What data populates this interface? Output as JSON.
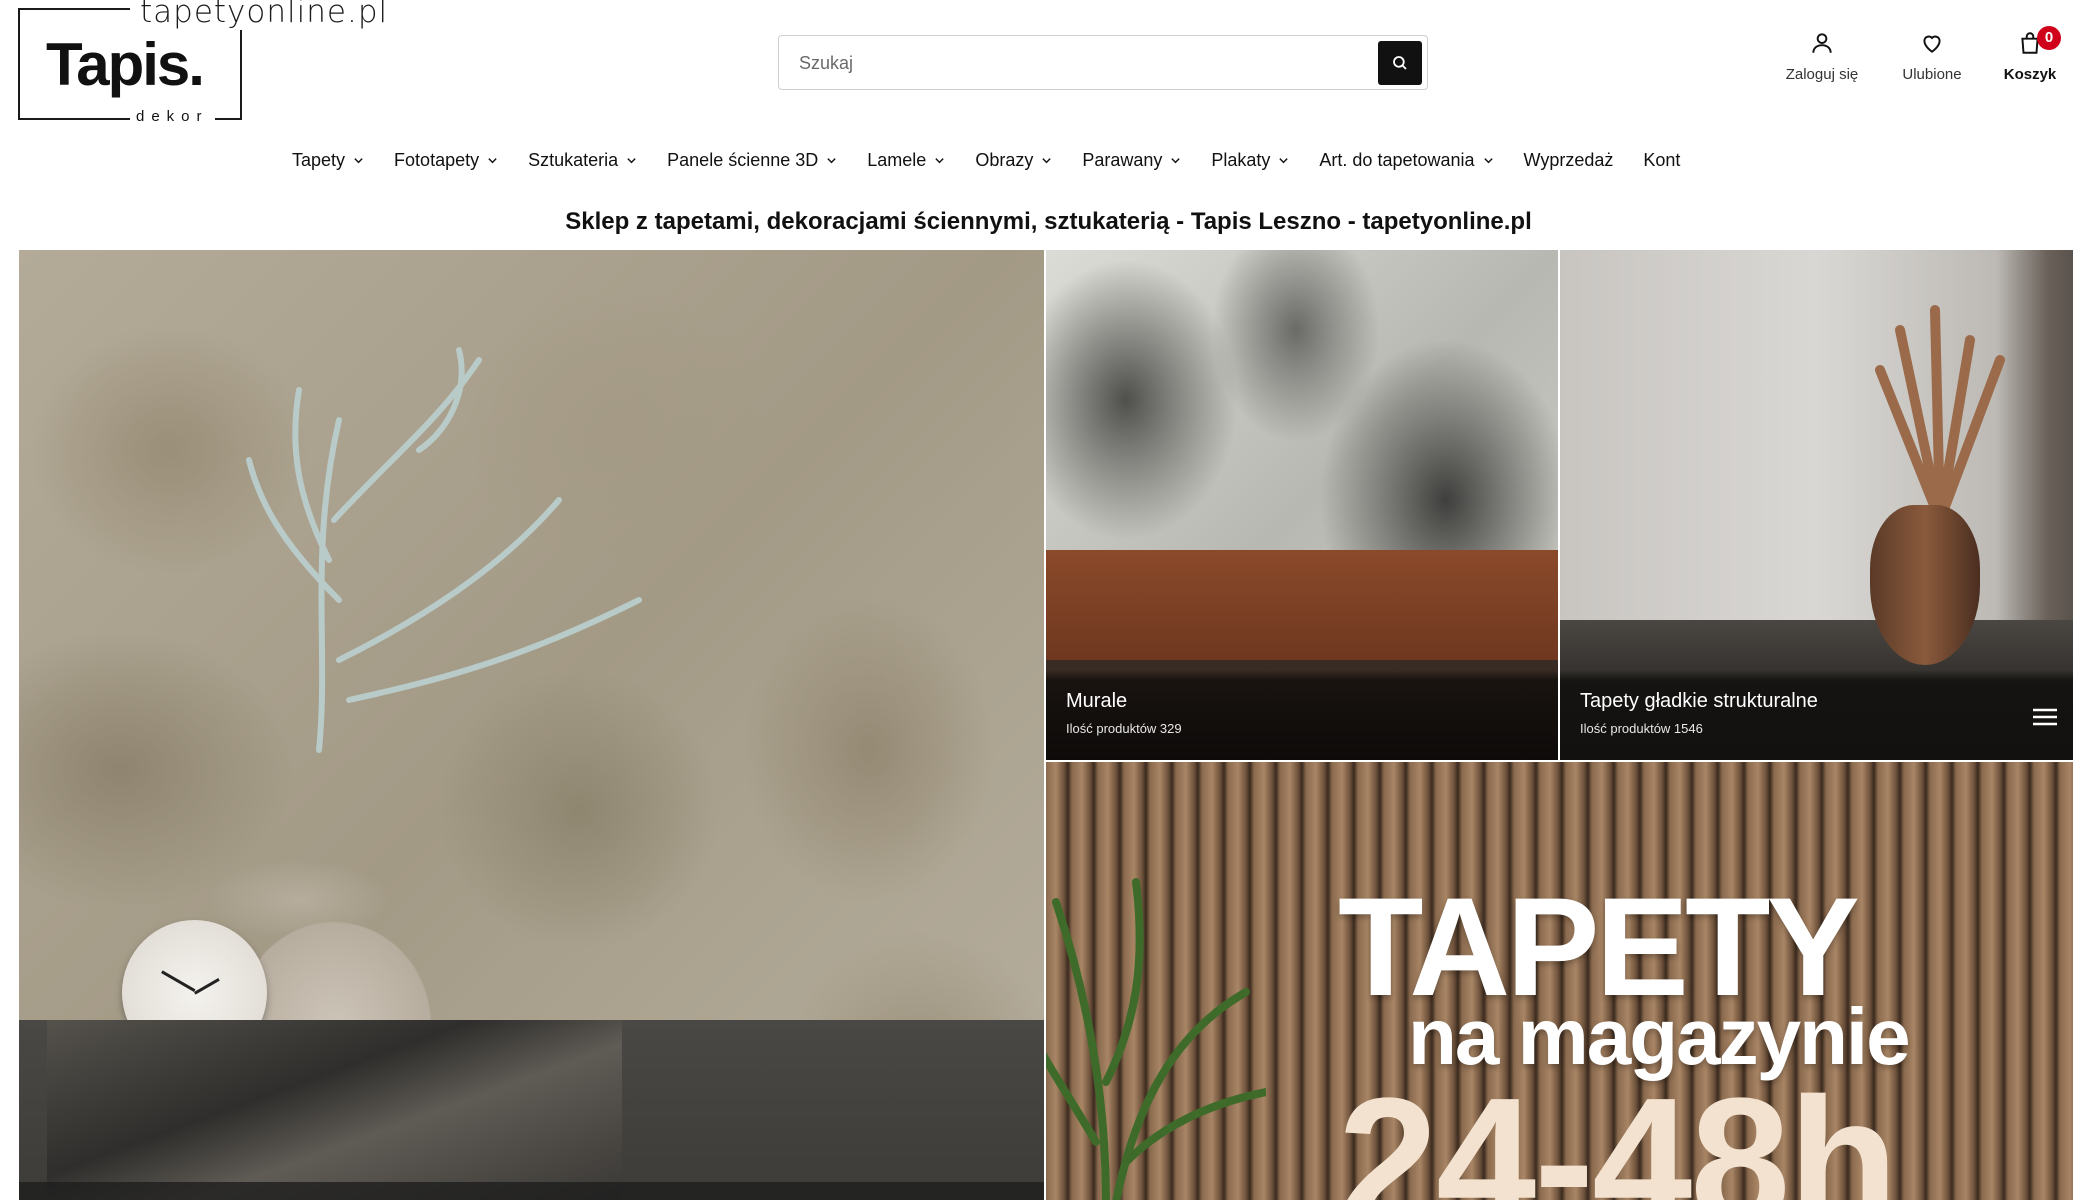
{
  "header": {
    "logo": {
      "domain": "tapetyonline.pl",
      "name": "Tapis.",
      "sub": "dekor"
    },
    "search": {
      "placeholder": "Szukaj",
      "icon": "search-icon"
    },
    "account": {
      "label": "Zaloguj się",
      "icon": "user-icon"
    },
    "favorites": {
      "label": "Ulubione",
      "icon": "heart-icon"
    },
    "cart": {
      "label": "Koszyk",
      "count": "0",
      "icon": "shopping-bag-icon"
    }
  },
  "nav": {
    "items": [
      {
        "label": "Tapety",
        "has_dropdown": true
      },
      {
        "label": "Fototapety",
        "has_dropdown": true
      },
      {
        "label": "Sztukateria",
        "has_dropdown": true
      },
      {
        "label": "Panele ścienne 3D",
        "has_dropdown": true
      },
      {
        "label": "Lamele",
        "has_dropdown": true
      },
      {
        "label": "Obrazy",
        "has_dropdown": true
      },
      {
        "label": "Parawany",
        "has_dropdown": true
      },
      {
        "label": "Plakaty",
        "has_dropdown": true
      },
      {
        "label": "Art. do tapetowania",
        "has_dropdown": true
      },
      {
        "label": "Wyprzedaż",
        "has_dropdown": false
      },
      {
        "label": "Kont",
        "has_dropdown": false
      }
    ]
  },
  "tagline": "Sklep z tapetami, dekoracjami ściennymi, sztukaterią - Tapis Leszno - tapetyonline.pl",
  "tiles": {
    "murale": {
      "title": "Murale",
      "count": "Ilość produktów 329"
    },
    "gladkie": {
      "title": "Tapety gładkie strukturalne",
      "count": "Ilość produktów 1546",
      "icon": "menu-icon"
    },
    "promo": {
      "line1": "TAPETY",
      "line2": "na magazynie",
      "line3": "24-48h"
    }
  }
}
